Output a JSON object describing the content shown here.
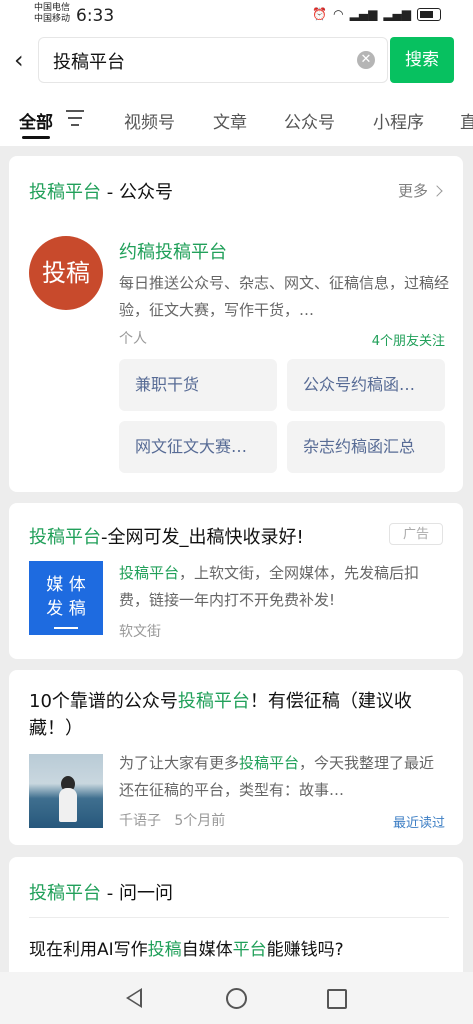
{
  "status": {
    "carrier1": "中国电信",
    "carrier2": "中国移动",
    "time": "6:33",
    "icons": [
      "alarm-icon",
      "wifi-icon",
      "signal-icon",
      "signal-icon",
      "battery-icon"
    ]
  },
  "search": {
    "query": "投稿平台",
    "button": "搜索"
  },
  "tabs": [
    "全部",
    "视频号",
    "文章",
    "公众号",
    "小程序",
    "直"
  ],
  "account_section": {
    "title_hl": "投稿平台",
    "title_rest": " - 公众号",
    "more": "更多",
    "avatar_text": "投稿",
    "name": "约稿投稿平台",
    "desc": "每日推送公众号、杂志、网文、征稿信息，过稿经验，征文大赛，写作干货，…",
    "type": "个人",
    "friends": "4个朋友关注",
    "menu": [
      "兼职干货",
      "公众号约稿函…",
      "网文征文大赛…",
      "杂志约稿函汇总"
    ]
  },
  "ad": {
    "title_hl": "投稿平台",
    "title_rest": "-全网可发_出稿快收录好!",
    "badge": "广告",
    "thumb_line1": "媒 体",
    "thumb_line2": "发 稿",
    "desc_hl": "投稿平台",
    "desc_rest": "，上软文街，全网媒体，先发稿后扣费，链接一年内打不开免费补发!",
    "source": "软文街"
  },
  "article": {
    "title_pre": "10个靠谱的公众号",
    "title_hl": "投稿平台",
    "title_post": "！有偿征稿（建议收藏！）",
    "desc_pre": "为了让大家有更多",
    "desc_hl": "投稿平台",
    "desc_post": "，今天我整理了最近还在征稿的平台，类型有：故事…",
    "author": "千语子",
    "time": "5个月前",
    "tag": "最近读过"
  },
  "qa": {
    "title_hl": "投稿平台",
    "title_rest": " - 问一问",
    "q_pre": "现在利用AI写作",
    "q_hl1": "投稿",
    "q_mid": "自媒体",
    "q_hl2": "平台",
    "q_post": "能赚钱吗?"
  },
  "colors": {
    "accent": "#07c160",
    "highlight": "#21a05a",
    "link": "#576b95",
    "avatar": "#c84a2c",
    "ad_thumb": "#1e6be0"
  }
}
